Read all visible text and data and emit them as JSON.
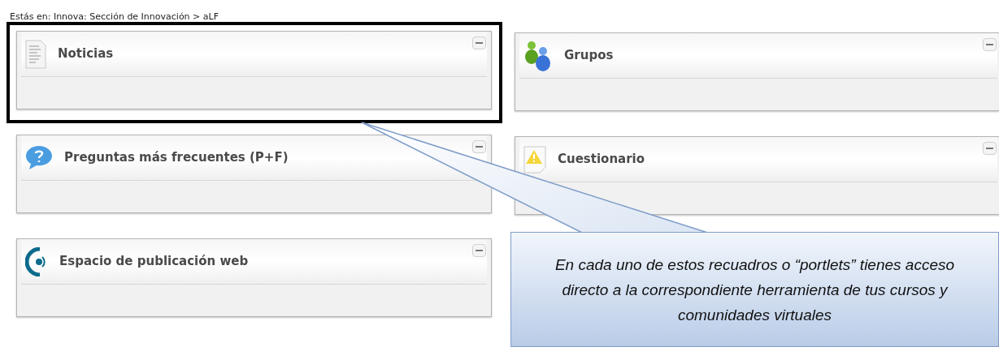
{
  "breadcrumb": "Estás en: Innova: Sección de Innovación > aLF",
  "columns": [
    {
      "portlets": [
        {
          "kind": "document",
          "title": "Noticias",
          "highlighted": true
        },
        {
          "kind": "question",
          "title": "Preguntas más frecuentes (P+F)",
          "highlighted": false
        },
        {
          "kind": "publish",
          "title": "Espacio de publicación web",
          "highlighted": false
        }
      ]
    },
    {
      "portlets": [
        {
          "kind": "people",
          "title": "Grupos",
          "highlighted": false
        },
        {
          "kind": "warning",
          "title": "Cuestionario",
          "highlighted": false
        }
      ]
    }
  ],
  "callout": {
    "text": "En cada uno de estos recuadros o “portlets” tienes acceso directo a la correspondiente herramienta de tus cursos y comunidades virtuales"
  }
}
